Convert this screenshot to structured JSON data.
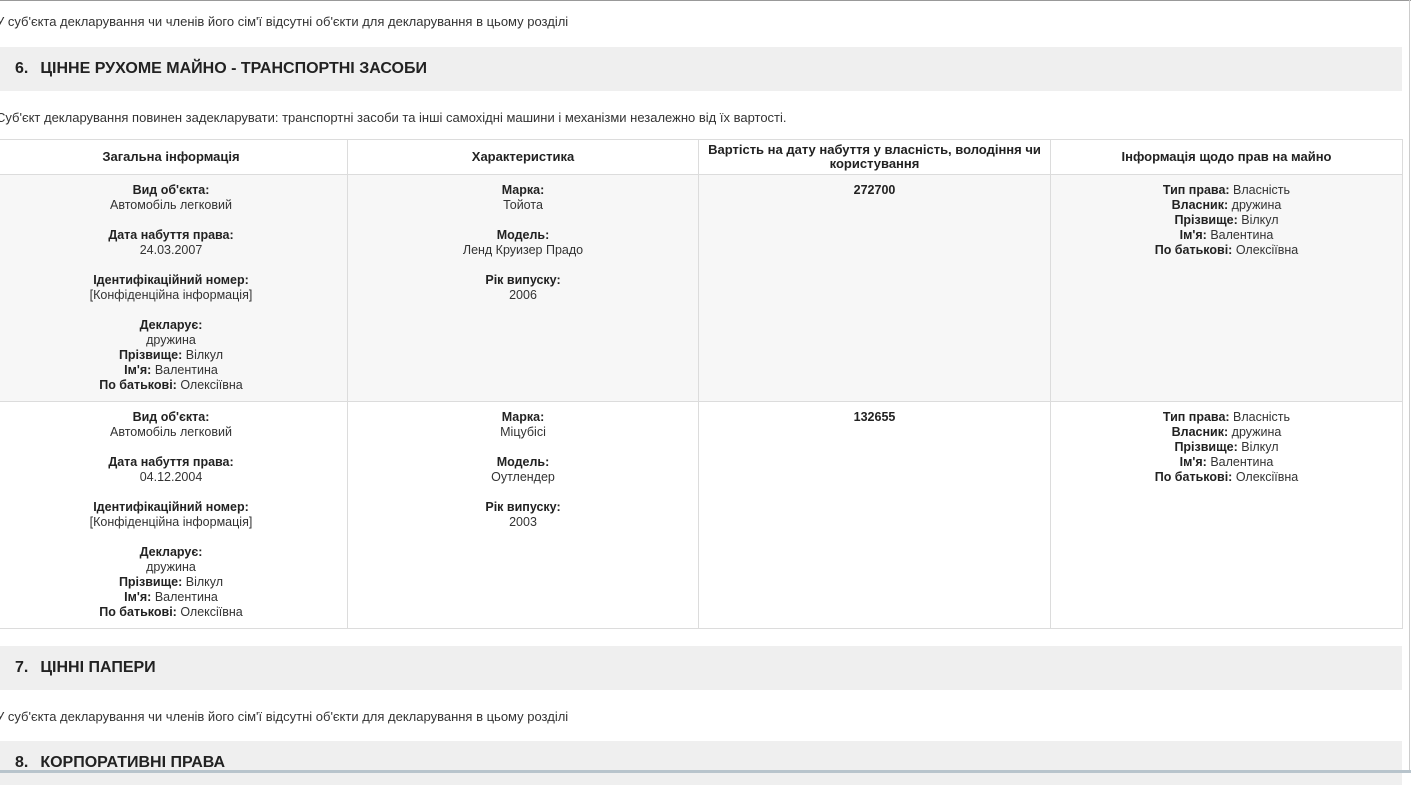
{
  "top_note": "У суб'єкта декларування чи членів його сім'ї відсутні об'єкти для декларування в цьому розділі",
  "section6": {
    "number": "6.",
    "title": "ЦІННЕ РУХОМЕ МАЙНО - ТРАНСПОРТНІ ЗАСОБИ",
    "description": "Суб'єкт декларування повинен задекларувати: транспортні засоби та інші самохідні машини і механізми незалежно від їх вартості."
  },
  "table": {
    "headers": [
      "Загальна інформація",
      "Характеристика",
      "Вартість на дату набуття у власність, володіння чи користування",
      "Інформація щодо прав на майно"
    ],
    "labels": {
      "object_type": "Вид об'єкта:",
      "acquired": "Дата набуття права:",
      "id_number": "Ідентифікаційний номер:",
      "declarant": "Декларує:",
      "surname": "Прізвище:",
      "name": "Ім'я:",
      "patronymic": "По батькові:",
      "brand": "Марка:",
      "model": "Модель:",
      "year": "Рік випуску:",
      "right_type": "Тип права:",
      "owner": "Власник:"
    },
    "rows": [
      {
        "object_type": "Автомобіль легковий",
        "acquired": "24.03.2007",
        "id_number": "[Конфіденційна інформація]",
        "declarant": "дружина",
        "surname": "Вілкул",
        "name": "Валентина",
        "patronymic": "Олексіївна",
        "brand": "Тойота",
        "model": "Ленд Круизер Прадо",
        "year": "2006",
        "value": "272700",
        "right_type": "Власність",
        "owner": "дружина",
        "owner_surname": "Вілкул",
        "owner_name": "Валентина",
        "owner_patronymic": "Олексіївна"
      },
      {
        "object_type": "Автомобіль легковий",
        "acquired": "04.12.2004",
        "id_number": "[Конфіденційна інформація]",
        "declarant": "дружина",
        "surname": "Вілкул",
        "name": "Валентина",
        "patronymic": "Олексіївна",
        "brand": "Міцубісі",
        "model": "Оутлендер",
        "year": "2003",
        "value": "132655",
        "right_type": "Власність",
        "owner": "дружина",
        "owner_surname": "Вілкул",
        "owner_name": "Валентина",
        "owner_patronymic": "Олексіївна"
      }
    ]
  },
  "section7": {
    "number": "7.",
    "title": "ЦІННІ ПАПЕРИ",
    "note": "У суб'єкта декларування чи членів його сім'ї відсутні об'єкти для декларування в цьому розділі"
  },
  "section8": {
    "number": "8.",
    "title": "КОРПОРАТИВНІ ПРАВА"
  }
}
